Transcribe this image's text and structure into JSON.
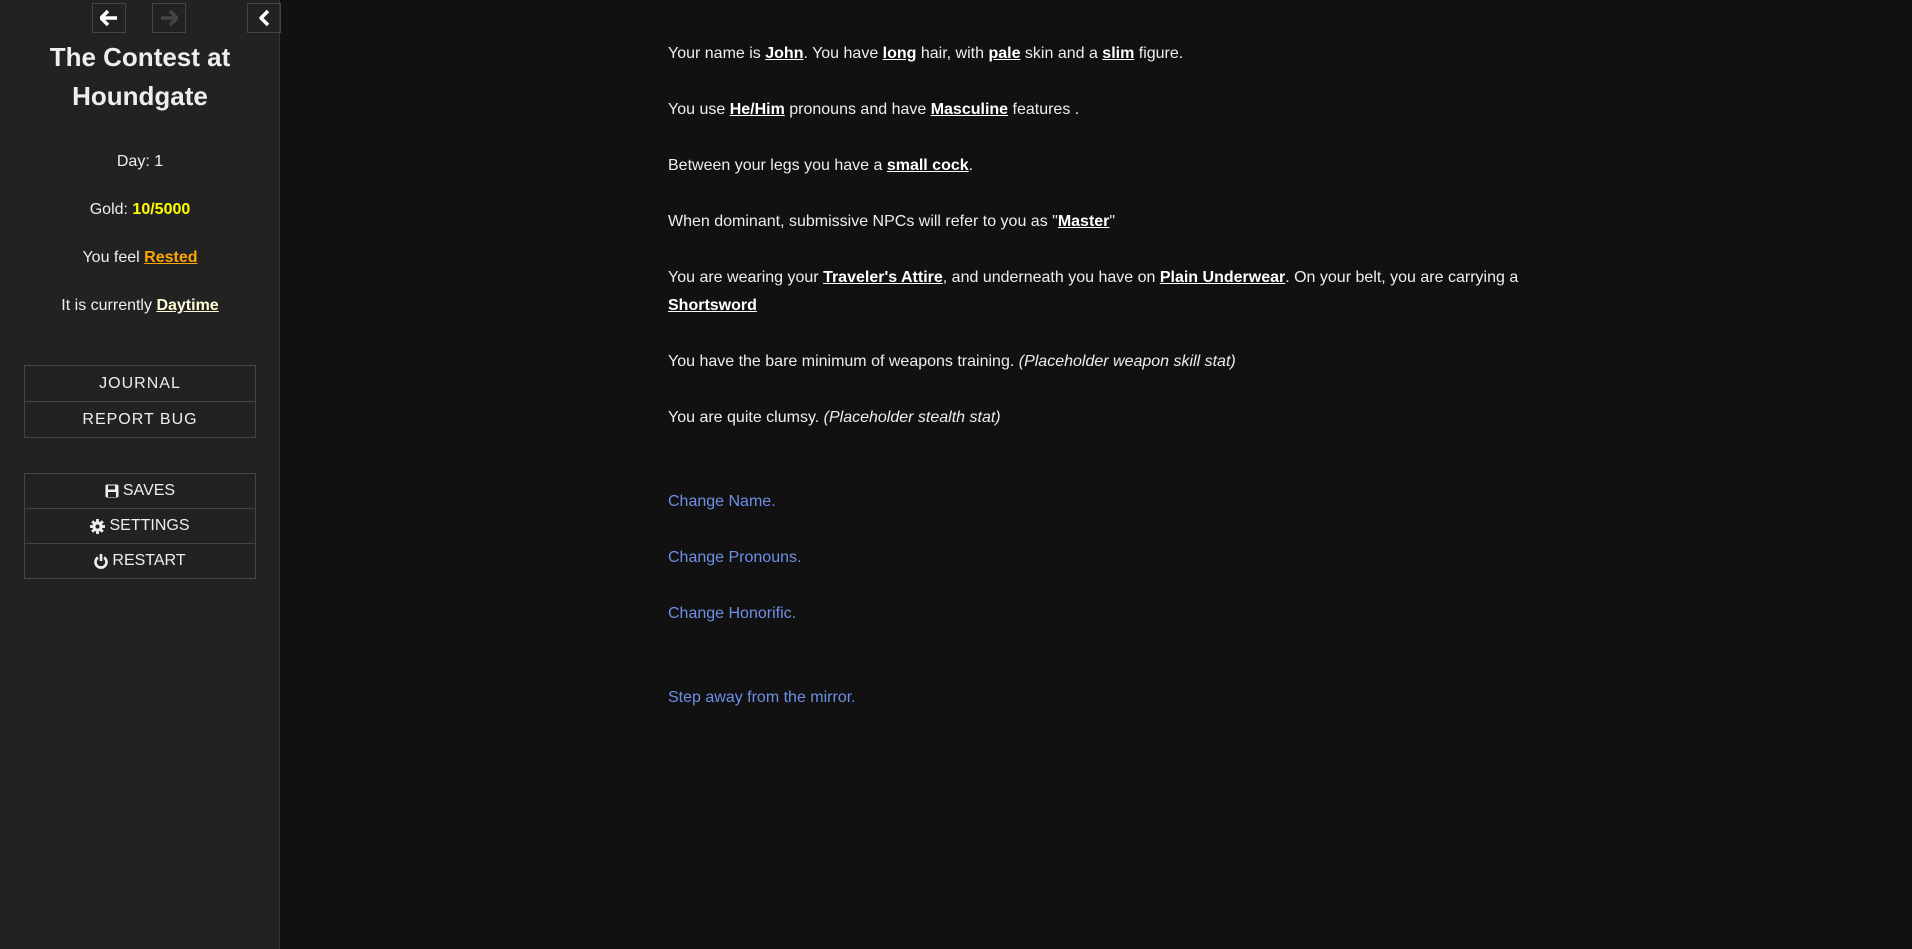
{
  "sidebar": {
    "nav": {
      "back_icon": "arrow-left-icon",
      "forward_icon": "arrow-right-icon",
      "toggle_icon": "chevron-left-icon"
    },
    "title": "The Contest at Houndgate",
    "day_label": "Day:",
    "day_value": "1",
    "gold_label": "Gold:",
    "gold_value": "10/5000",
    "feel_label": "You feel",
    "feel_value": "Rested",
    "time_label": "It is currently",
    "time_value": "Daytime",
    "menu1": [
      "JOURNAL",
      "REPORT BUG"
    ],
    "menu2": [
      {
        "label": "SAVES",
        "icon": "floppy-disk-icon"
      },
      {
        "label": "SETTINGS",
        "icon": "gear-icon"
      },
      {
        "label": "RESTART",
        "icon": "power-icon"
      }
    ]
  },
  "colors": {
    "gold": "#ffff00",
    "rested": "#ffa500",
    "link": "#6f8fe6",
    "background": "#111111",
    "sidebar": "#222222"
  },
  "passage": {
    "p1": {
      "t1": "Your name is ",
      "name": "John",
      "t2": ". You have ",
      "hair": "long",
      "t3": " hair, with ",
      "skin": "pale",
      "t4": " skin and a ",
      "figure": "slim",
      "t5": " figure."
    },
    "p2": {
      "t1": "You use ",
      "pronouns": "He/Him",
      "t2": " pronouns and have ",
      "features": "Masculine",
      "t3": " features ."
    },
    "p3": {
      "t1": "Between your legs you have a ",
      "genitals": "small cock",
      "t2": "."
    },
    "p4": {
      "t1": "When dominant, submissive NPCs will refer to you as \"",
      "honorific": "Master",
      "t2": "\""
    },
    "p5": {
      "t1": "You are wearing your ",
      "outfit": "Traveler's Attire",
      "t2": ", and underneath you have on ",
      "underwear": "Plain Underwear",
      "t3": ". On your belt, you are carrying a ",
      "weapon": "Shortsword"
    },
    "p6": {
      "t1": "You have the bare minimum of weapons training. ",
      "note": "(Placeholder weapon skill stat)"
    },
    "p7": {
      "t1": "You are quite clumsy. ",
      "note": "(Placeholder stealth stat)"
    },
    "links": [
      "Change Name.",
      "Change Pronouns.",
      "Change Honorific.",
      "Step away from the mirror."
    ]
  }
}
